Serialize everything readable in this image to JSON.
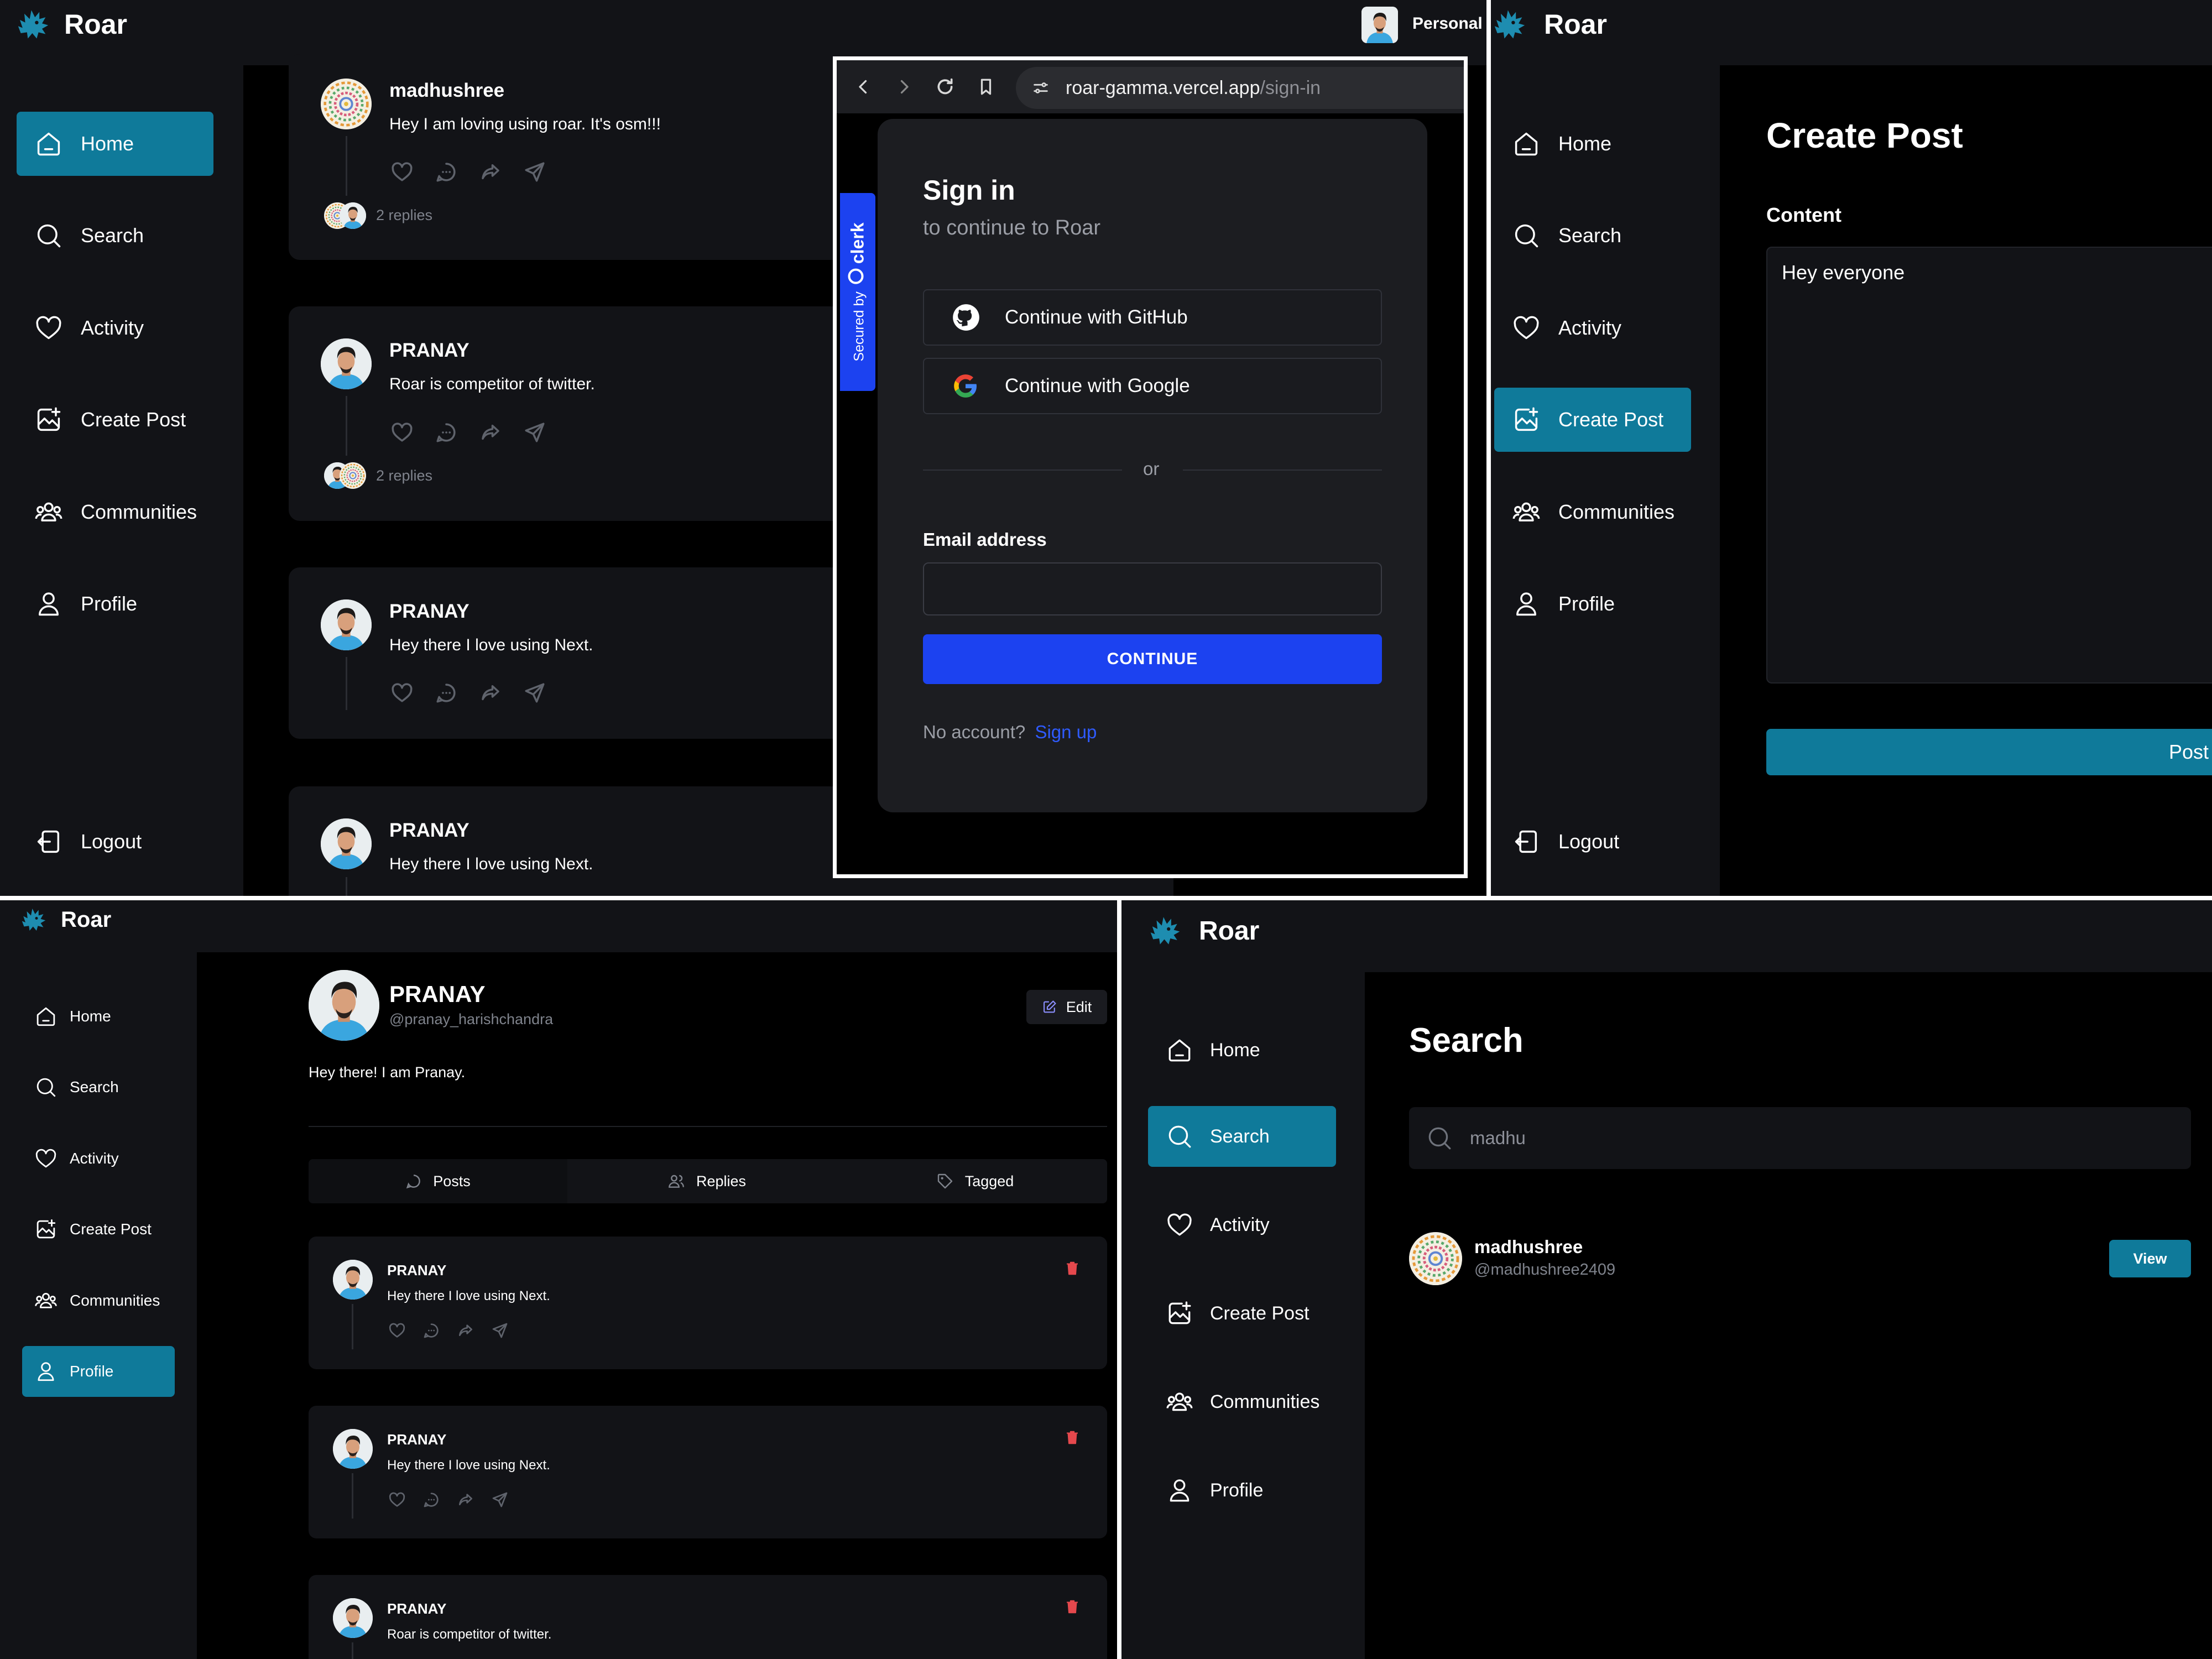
{
  "brand": {
    "name": "Roar",
    "accent": "#0f7a9a",
    "logo_icon": "lion-logo-icon"
  },
  "nav_labels": {
    "home": "Home",
    "search": "Search",
    "activity": "Activity",
    "create_post": "Create Post",
    "communities": "Communities",
    "profile": "Profile",
    "logout": "Logout"
  },
  "home_panel": {
    "org_label": "Personal",
    "threads": [
      {
        "author": "madhushree",
        "text": "Hey I am loving using roar. It's osm!!!",
        "replies": "2 replies"
      },
      {
        "author": "PRANAY",
        "text": "Roar is competitor of twitter.",
        "replies": "2 replies"
      },
      {
        "author": "PRANAY",
        "text": "Hey there I love using Next.",
        "replies": ""
      },
      {
        "author": "PRANAY",
        "text": "Hey there I love using Next.",
        "replies": ""
      }
    ]
  },
  "browser": {
    "url_host": "roar-gamma.vercel.app",
    "url_path": "/sign-in",
    "secured_by": "Secured by",
    "clerk_label": "clerk"
  },
  "signin": {
    "title": "Sign in",
    "subtitle": "to continue to Roar",
    "github_label": "Continue with GitHub",
    "google_label": "Continue with Google",
    "divider": "or",
    "email_label": "Email address",
    "email_value": "",
    "continue_label": "CONTINUE",
    "no_account": "No account?",
    "signup_link": "Sign up",
    "primary_color": "#1c42f0"
  },
  "create_post_panel": {
    "title": "Create Post",
    "content_label": "Content",
    "content_value": "Hey everyone",
    "post_button": "Post"
  },
  "profile_panel": {
    "name": "PRANAY",
    "username": "@pranay_harishchandra",
    "edit_label": "Edit",
    "bio": "Hey there! I am Pranay.",
    "tabs": [
      "Posts",
      "Replies",
      "Tagged"
    ],
    "posts": [
      {
        "author": "PRANAY",
        "text": "Hey there I love using Next."
      },
      {
        "author": "PRANAY",
        "text": "Hey there I love using Next."
      },
      {
        "author": "PRANAY",
        "text": "Roar is competitor of twitter."
      }
    ],
    "delete_color": "#e5484d"
  },
  "search_panel": {
    "title": "Search",
    "query": "madhu",
    "result": {
      "name": "madhushree",
      "username": "@madhushree2409",
      "view_label": "View"
    }
  }
}
